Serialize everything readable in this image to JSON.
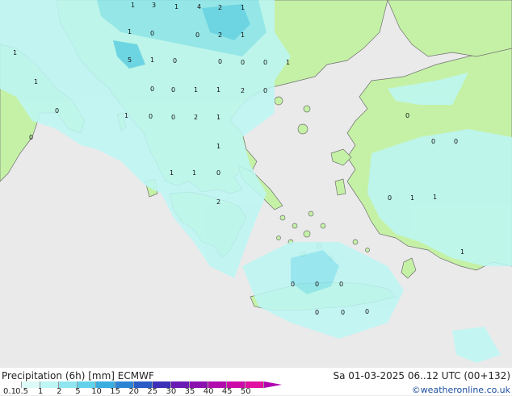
{
  "map": {
    "colors": {
      "sea": "#eaeaea",
      "land": "#c5f1a6",
      "precip_light": "#bdf6f4",
      "precip_mid": "#8fe6f0",
      "precip_heavy": "#62d2ea",
      "coast": "#6f6f6f"
    },
    "point_values": [
      "1",
      "3",
      "1",
      "4",
      "2",
      "1",
      "1",
      "2",
      "1",
      "0",
      "0",
      "1",
      "5",
      "1",
      "0",
      "0",
      "0",
      "0",
      "1",
      "1",
      "0",
      "0",
      "1",
      "1",
      "2",
      "0",
      "1",
      "0",
      "2",
      "0",
      "0",
      "1",
      "1",
      "0",
      "1",
      "2",
      "0",
      "1",
      "0",
      "0",
      "1",
      "0",
      "1",
      "0",
      "0",
      "0",
      "0",
      "0",
      "0",
      "0",
      "1"
    ]
  },
  "footer": {
    "title_left": "Precipitation (6h) [mm] ECMWF",
    "title_right": "Sa 01-03-2025 06..12 UTC (00+132)",
    "credit": "©weatheronline.co.uk",
    "legend_labels": [
      "0.1",
      "0.5",
      "1",
      "2",
      "5",
      "10",
      "15",
      "20",
      "25",
      "30",
      "35",
      "40",
      "45",
      "50"
    ],
    "legend_colors": [
      "#fefefe",
      "#dcfaf8",
      "#bdf6f4",
      "#8fe6f0",
      "#62d2ea",
      "#3aaee0",
      "#2e84d4",
      "#2a5cc6",
      "#3c30b8",
      "#6a1cb4",
      "#8c12b0",
      "#b00cae",
      "#cc0aa8",
      "#e010a0"
    ]
  }
}
